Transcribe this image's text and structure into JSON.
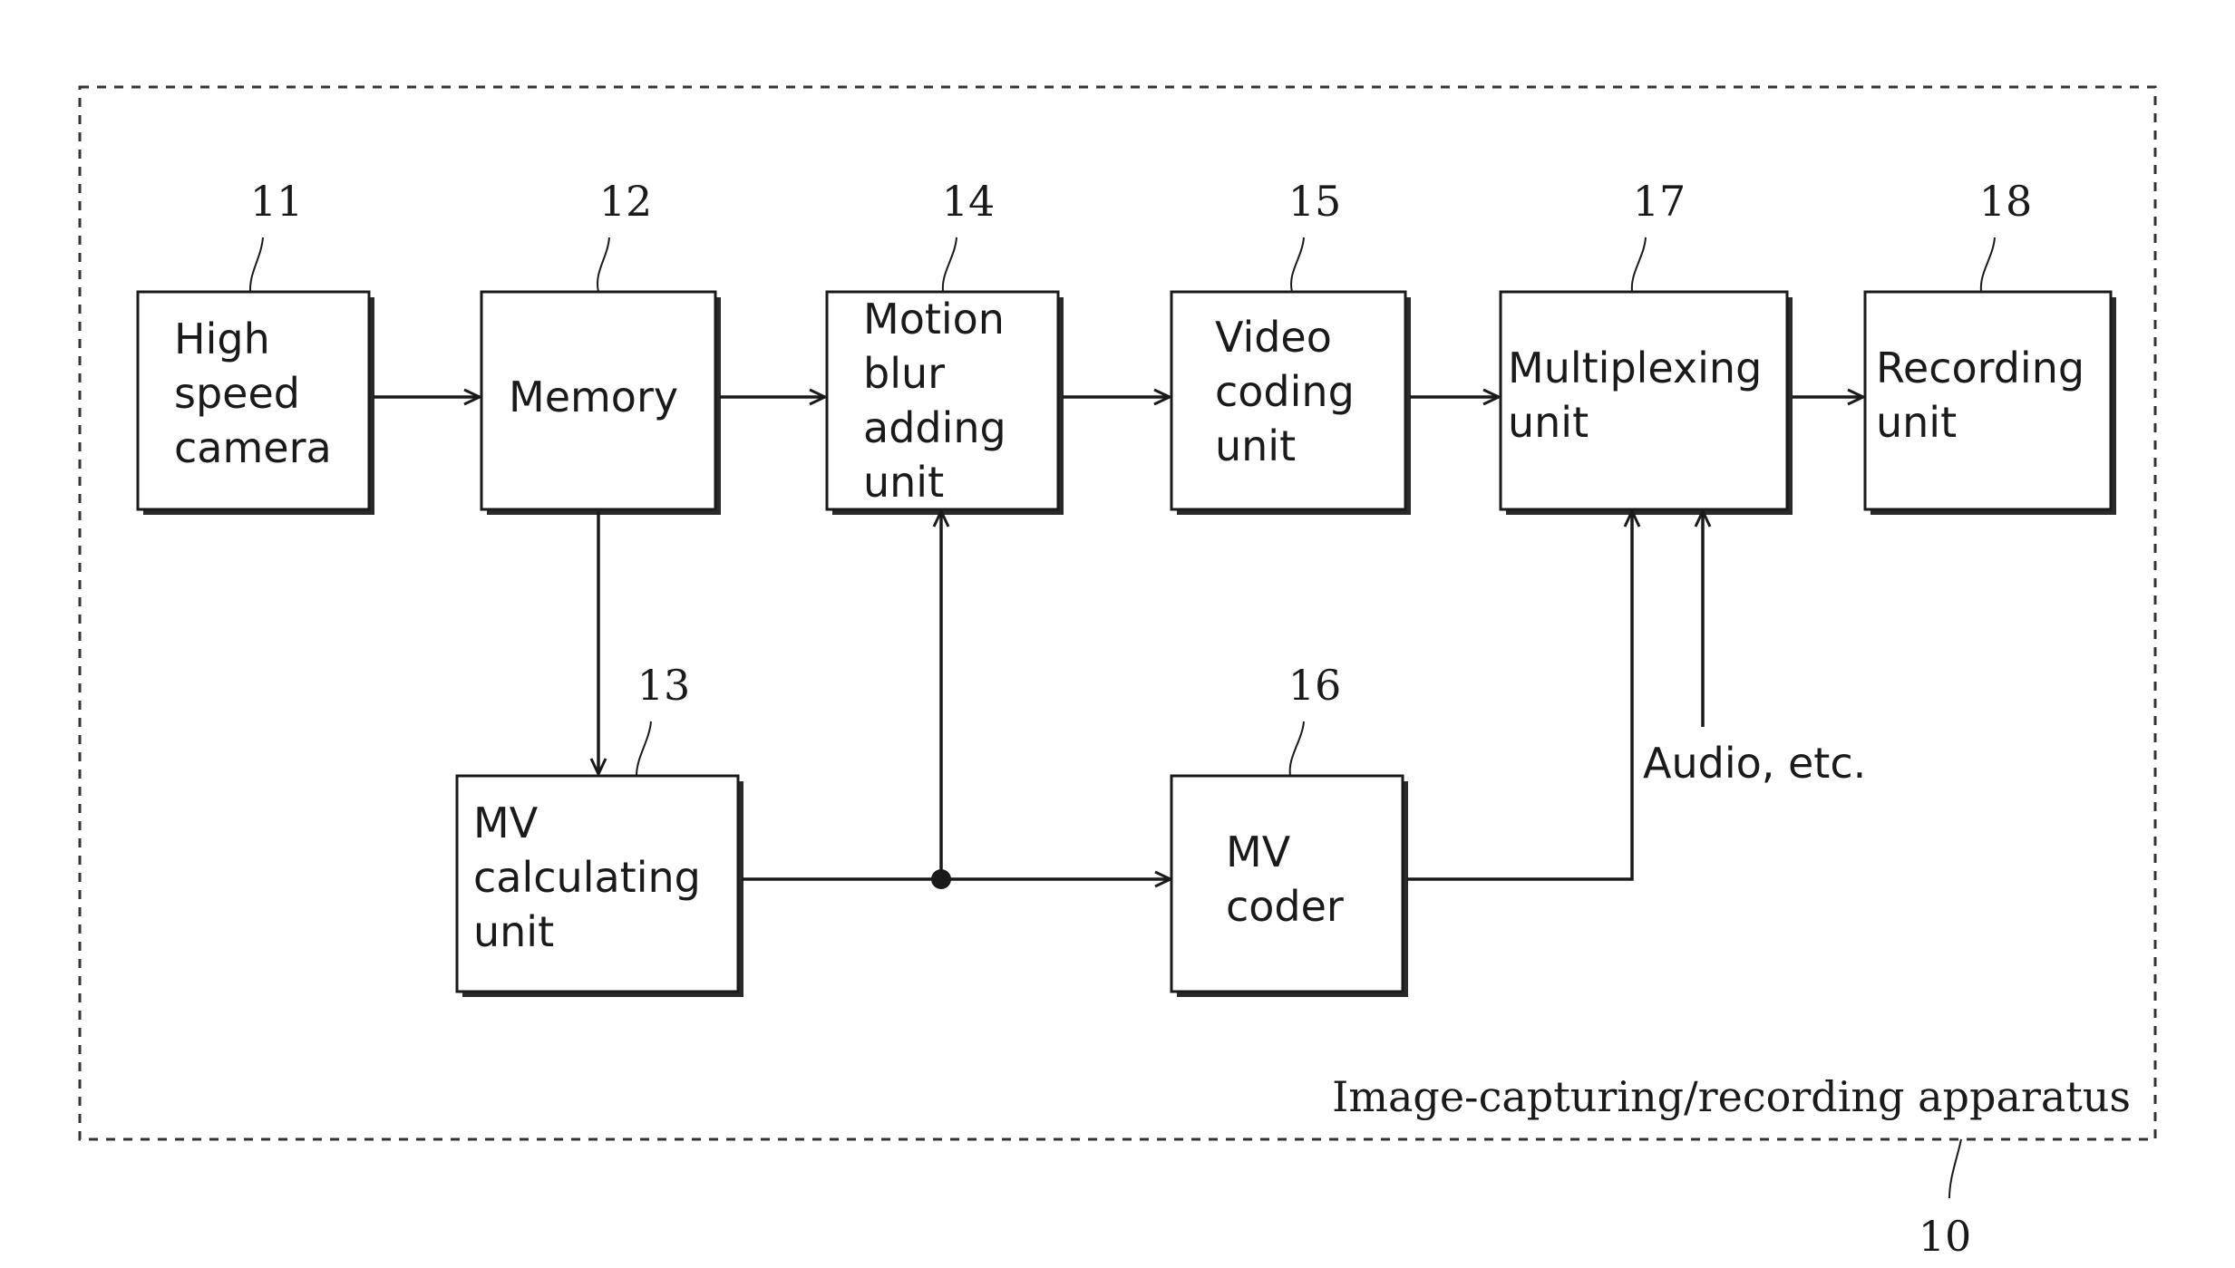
{
  "diagram": {
    "caption": "Image-capturing/recording apparatus",
    "apparatus_ref": "10",
    "side_input_label": "Audio, etc.",
    "blocks": [
      {
        "id": "high-speed-camera",
        "ref": "11",
        "lines": [
          "High",
          "speed",
          "camera"
        ]
      },
      {
        "id": "memory",
        "ref": "12",
        "lines": [
          "Memory"
        ]
      },
      {
        "id": "mv-calculating-unit",
        "ref": "13",
        "lines": [
          "MV",
          "calculating",
          "unit"
        ]
      },
      {
        "id": "motion-blur-adding-unit",
        "ref": "14",
        "lines": [
          "Motion",
          "blur",
          "adding",
          "unit"
        ]
      },
      {
        "id": "video-coding-unit",
        "ref": "15",
        "lines": [
          "Video",
          "coding",
          "unit"
        ]
      },
      {
        "id": "mv-coder",
        "ref": "16",
        "lines": [
          "MV",
          "coder"
        ]
      },
      {
        "id": "multiplexing-unit",
        "ref": "17",
        "lines": [
          "Multiplexing",
          "unit"
        ]
      },
      {
        "id": "recording-unit",
        "ref": "18",
        "lines": [
          "Recording",
          "unit"
        ]
      }
    ],
    "connections": [
      {
        "from": "high-speed-camera",
        "to": "memory"
      },
      {
        "from": "memory",
        "to": "motion-blur-adding-unit"
      },
      {
        "from": "memory",
        "to": "mv-calculating-unit"
      },
      {
        "from": "mv-calculating-unit",
        "to": "motion-blur-adding-unit"
      },
      {
        "from": "mv-calculating-unit",
        "to": "mv-coder"
      },
      {
        "from": "motion-blur-adding-unit",
        "to": "video-coding-unit"
      },
      {
        "from": "video-coding-unit",
        "to": "multiplexing-unit"
      },
      {
        "from": "mv-coder",
        "to": "multiplexing-unit"
      },
      {
        "from": "Audio, etc.",
        "to": "multiplexing-unit"
      },
      {
        "from": "multiplexing-unit",
        "to": "recording-unit"
      }
    ]
  }
}
